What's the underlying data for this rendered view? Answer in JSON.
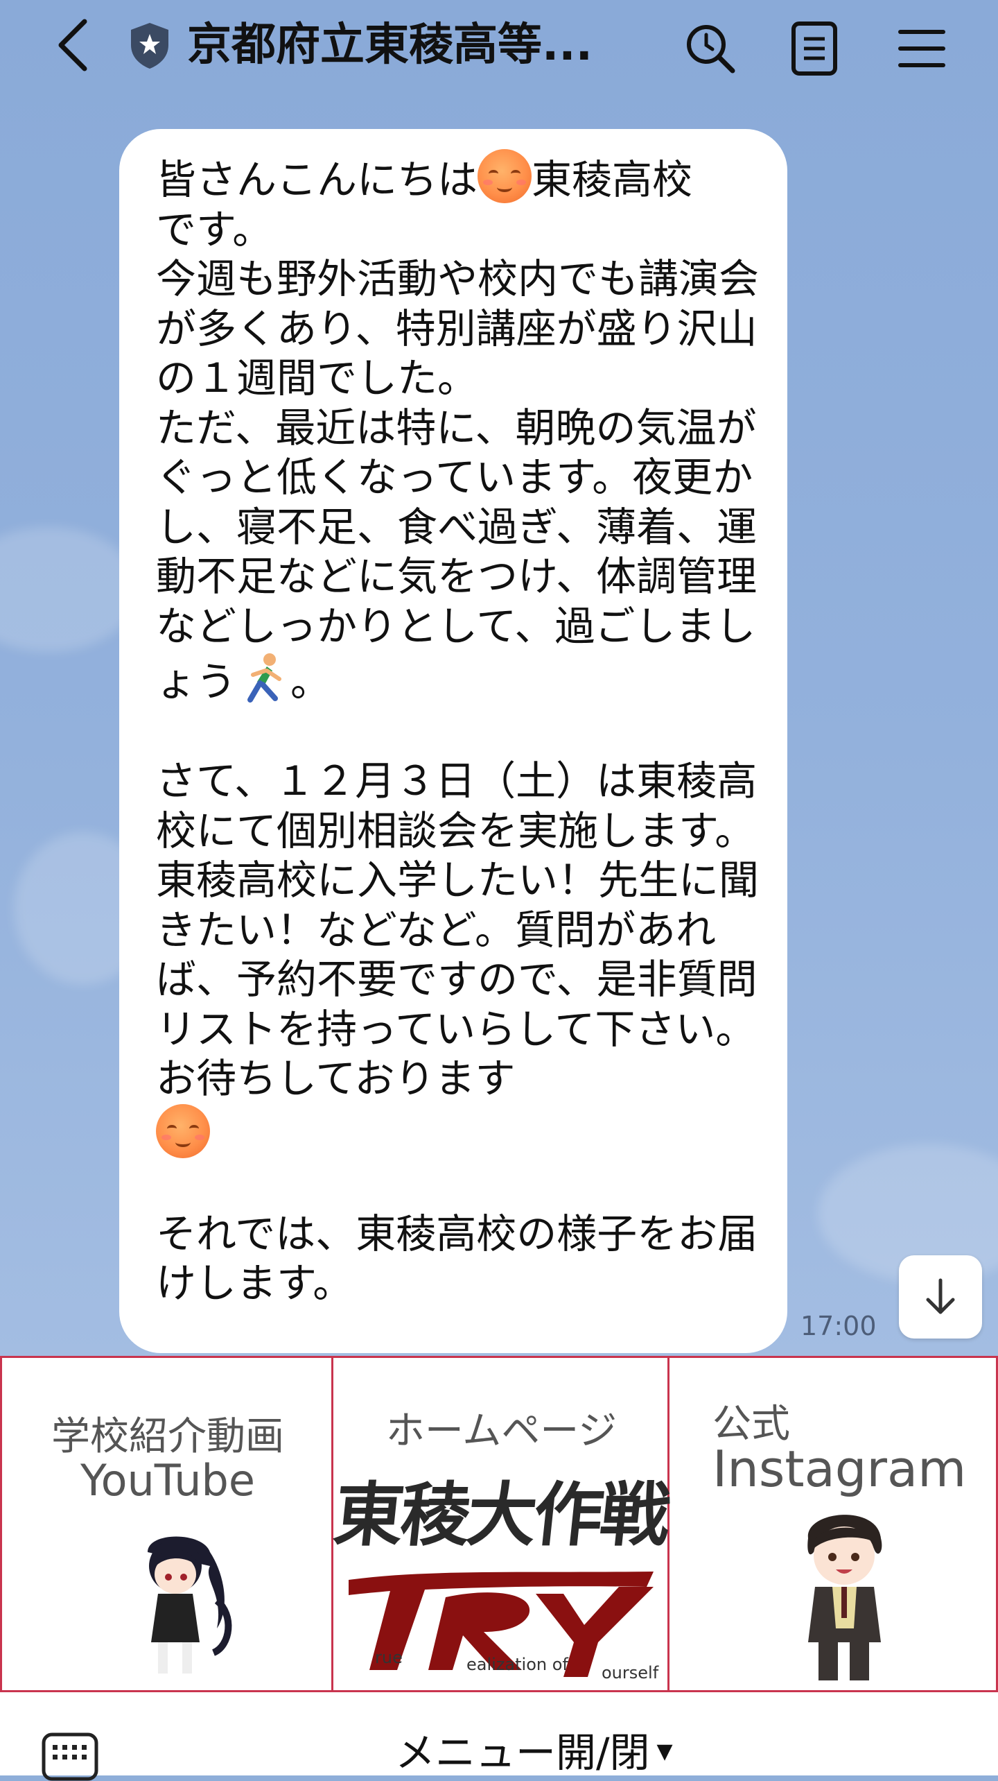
{
  "header": {
    "title": "京都府立東稜高等...",
    "icons": [
      "back-icon",
      "shield-star-icon",
      "search-icon",
      "notes-icon",
      "hamburger-menu-icon"
    ]
  },
  "message": {
    "text_1": "皆さんこんにちは",
    "text_2": "東稜高校\nです。\n今週も野外活動や校内でも講演会が多くあり、特別講座が盛り沢山の１週間でした。\nただ、最近は特に、朝晩の気温がぐっと低くなっています。夜更かし、寝不足、食べ過ぎ、薄着、運動不足などに気をつけ、体調管理などしっかりとして、過ごしましょう",
    "text_3": "。\n\nさて、１２月３日（土）は東稜高校にて個別相談会を実施します。東稜高校に入学したい！先生に聞きたい！などなど。質問があれば、予約不要ですので、是非質問リストを持っていらして下さい。お待ちしております\n",
    "text_4": "\n\nそれでは、東稜高校の様子をお届けします。",
    "emojis": [
      "smiling-face-icon",
      "runner-icon",
      "winking-face-icon"
    ],
    "time": "17:00"
  },
  "rich_menu": {
    "cell1": {
      "label1": "学校紹介動画",
      "label2": "YouTube"
    },
    "cell2": {
      "label1": "ホームページ",
      "label2": "東稜大作戦",
      "logo_text": "TRY",
      "logo_sub1": "rue",
      "logo_sub2": "ealization of",
      "logo_sub3": "ourself"
    },
    "cell3": {
      "label1": "公式",
      "label2": "Instagram"
    }
  },
  "bottom": {
    "menu_toggle": "メニュー開/閉",
    "caret": "▼"
  },
  "colors": {
    "chat_bg": "#8eaed9",
    "rich_border": "#c9344e",
    "try_red": "#8a1010"
  }
}
